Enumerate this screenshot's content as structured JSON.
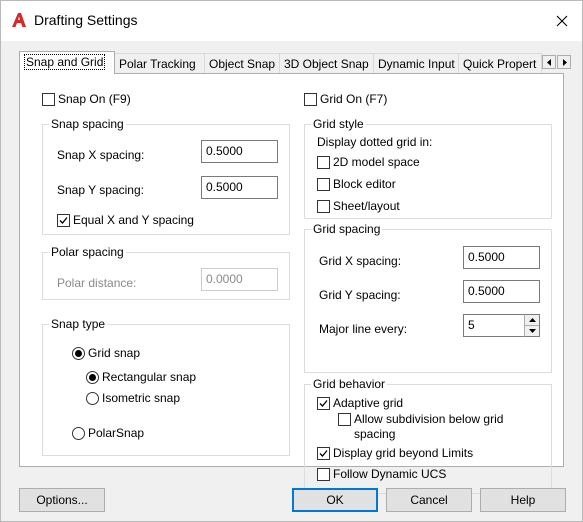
{
  "window": {
    "title": "Drafting Settings",
    "logo_icon": "autocad-logo",
    "close_icon": "close-icon"
  },
  "tabs": [
    {
      "label": "Snap and Grid",
      "active": true
    },
    {
      "label": "Polar Tracking"
    },
    {
      "label": "Object Snap"
    },
    {
      "label": "3D Object Snap"
    },
    {
      "label": "Dynamic Input"
    },
    {
      "label": "Quick Propert"
    }
  ],
  "snap_on": {
    "label": "Snap On (F9)",
    "checked": false
  },
  "grid_on": {
    "label": "Grid On (F7)",
    "checked": false
  },
  "snap_spacing": {
    "title": "Snap spacing",
    "x_label": "Snap X spacing:",
    "x_value": "0.5000",
    "y_label": "Snap Y spacing:",
    "y_value": "0.5000",
    "equal_label": "Equal X and Y spacing",
    "equal_checked": true
  },
  "polar_spacing": {
    "title": "Polar spacing",
    "distance_label": "Polar distance:",
    "distance_value": "0.0000"
  },
  "snap_type": {
    "title": "Snap type",
    "grid_snap": "Grid snap",
    "rectangular": "Rectangular snap",
    "isometric": "Isometric snap",
    "polar": "PolarSnap"
  },
  "grid_style": {
    "title": "Grid style",
    "display_label": "Display dotted grid in:",
    "model_space": "2D model space",
    "block_editor": "Block editor",
    "sheet_layout": "Sheet/layout"
  },
  "grid_spacing": {
    "title": "Grid spacing",
    "x_label": "Grid X spacing:",
    "x_value": "0.5000",
    "y_label": "Grid Y spacing:",
    "y_value": "0.5000",
    "major_label": "Major line every:",
    "major_value": "5"
  },
  "grid_behavior": {
    "title": "Grid behavior",
    "adaptive": "Adaptive grid",
    "adaptive_checked": true,
    "subdivision_line1": "Allow subdivision below grid",
    "subdivision_line2": "spacing",
    "beyond_limits": "Display grid beyond Limits",
    "beyond_checked": true,
    "follow_ucs": "Follow Dynamic UCS"
  },
  "buttons": {
    "options": "Options...",
    "ok": "OK",
    "cancel": "Cancel",
    "help": "Help"
  }
}
